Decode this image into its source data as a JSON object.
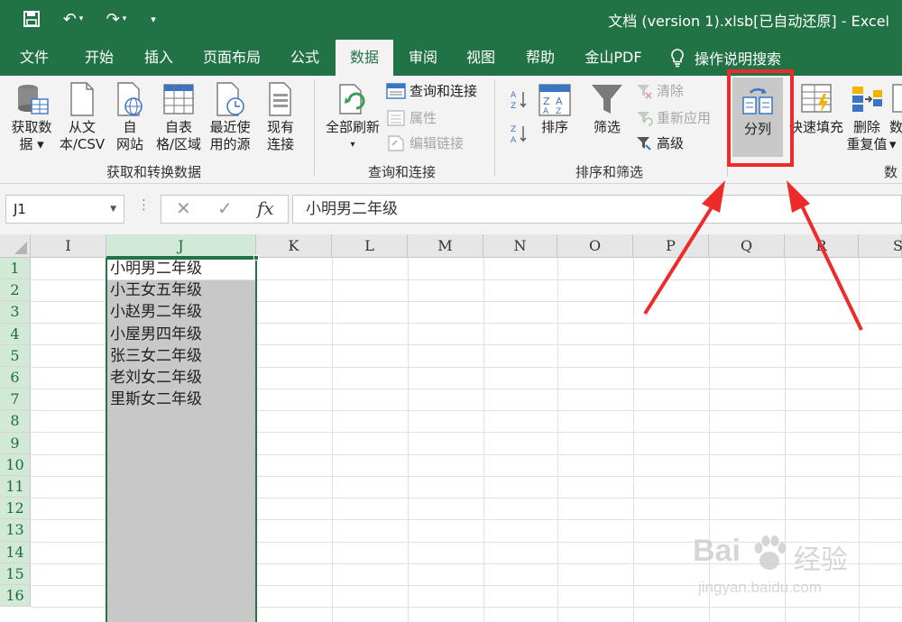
{
  "window": {
    "title": "文档 (version 1).xlsb[已自动还原]  -  Excel"
  },
  "tabs": [
    "文件",
    "开始",
    "插入",
    "页面布局",
    "公式",
    "数据",
    "审阅",
    "视图",
    "帮助",
    "金山PDF"
  ],
  "active_tab": "数据",
  "tell_me": "操作说明搜索",
  "ribbon": {
    "get_data": {
      "label1": "获取数",
      "label2": "据 ▾"
    },
    "from_text": {
      "label1": "从文",
      "label2": "本/CSV"
    },
    "from_web": {
      "label1": "自",
      "label2": "网站"
    },
    "from_table": {
      "label1": "自表",
      "label2": "格/区域"
    },
    "recent_sources": {
      "label1": "最近使",
      "label2": "用的源"
    },
    "existing": {
      "label1": "现有",
      "label2": "连接"
    },
    "group_get_transform": "获取和转换数据",
    "refresh_all": {
      "label1": "全部刷新",
      "label2": "▾"
    },
    "queries_connections": "查询和连接",
    "properties": "属性",
    "edit_links": "编辑链接",
    "group_queries": "查询和连接",
    "sort": "排序",
    "filter": "筛选",
    "clear": "清除",
    "reapply": "重新应用",
    "advanced": "高级",
    "group_sort_filter": "排序和筛选",
    "text_to_columns": "分列",
    "flash_fill": "快速填充",
    "remove_duplicates": {
      "label1": "删除",
      "label2": "重复值"
    },
    "data_validation": {
      "label1": "数",
      "label2": "▾"
    },
    "group_data_tools": "数"
  },
  "formula_bar": {
    "name_box": "J1",
    "formula": "小明男二年级"
  },
  "sheet": {
    "columns": [
      "I",
      "J",
      "K",
      "L",
      "M",
      "N",
      "O",
      "P",
      "Q",
      "R",
      "S"
    ],
    "rows": [
      "1",
      "2",
      "3",
      "4",
      "5",
      "6",
      "7",
      "8",
      "9",
      "10",
      "11",
      "12",
      "13",
      "14",
      "15",
      "16"
    ],
    "column_j_values": [
      "小明男二年级",
      "小王女五年级",
      "小赵男二年级",
      "小屋男四年级",
      "张三女二年级",
      "老刘女二年级",
      "里斯女二年级"
    ]
  },
  "watermark": {
    "line1": "Bai",
    "line2": "经验",
    "line3": "jingyan.baidu.com"
  },
  "colors": {
    "accent": "#217346",
    "highlight": "#ee2b2b",
    "selection": "#c8c8c8"
  }
}
